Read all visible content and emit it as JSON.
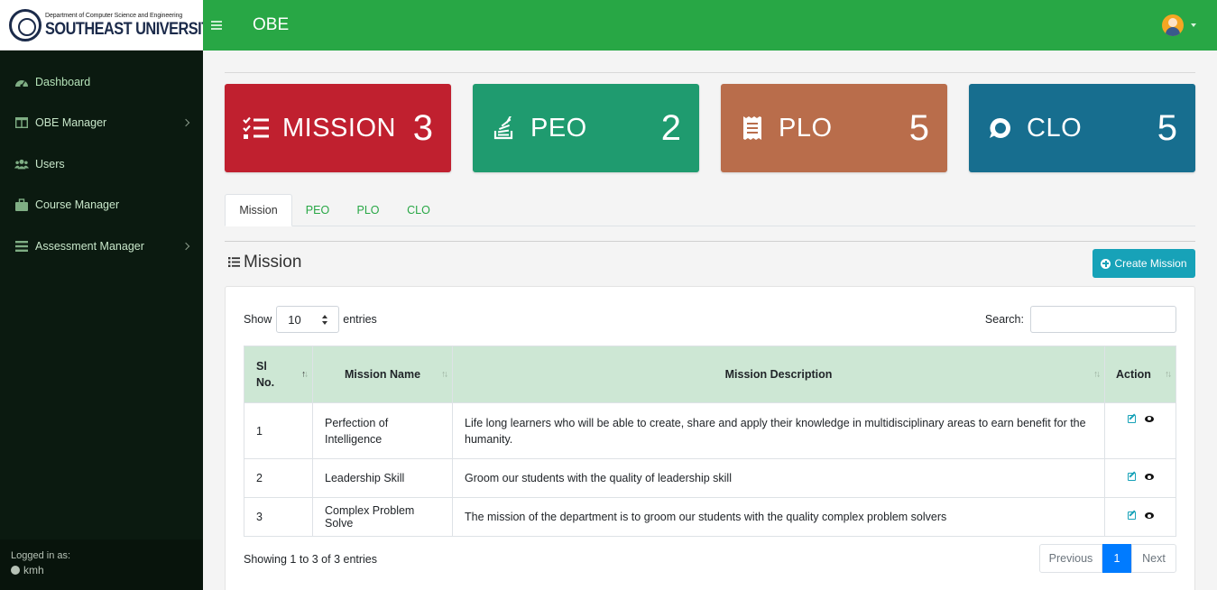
{
  "brand": {
    "dept": "Department of Computer Science and Engineering",
    "name": "SOUTHEAST UNIVERSITY"
  },
  "header": {
    "title": "OBE"
  },
  "sidebar": {
    "items": [
      {
        "label": "Dashboard",
        "icon": "dashboard-icon"
      },
      {
        "label": "OBE Manager",
        "icon": "table-icon",
        "has_submenu": true
      },
      {
        "label": "Users",
        "icon": "users-icon"
      },
      {
        "label": "Course Manager",
        "icon": "briefcase-icon"
      },
      {
        "label": "Assessment Manager",
        "icon": "menu-icon",
        "has_submenu": true
      }
    ],
    "footer": {
      "logged_in_label": "Logged in as:",
      "username": "kmh"
    }
  },
  "stats": [
    {
      "label": "MISSION",
      "value": "3",
      "color": "#c0202f",
      "icon": "tasks-icon"
    },
    {
      "label": "PEO",
      "value": "2",
      "color": "#1f9b6f",
      "icon": "stack-icon"
    },
    {
      "label": "PLO",
      "value": "5",
      "color": "#b96d4b",
      "icon": "receipt-icon"
    },
    {
      "label": "CLO",
      "value": "5",
      "color": "#176e8f",
      "icon": "comment-icon"
    }
  ],
  "tabs": [
    {
      "label": "Mission",
      "active": true
    },
    {
      "label": "PEO"
    },
    {
      "label": "PLO"
    },
    {
      "label": "CLO"
    }
  ],
  "section": {
    "title": "Mission",
    "create_label": "Create Mission"
  },
  "table": {
    "show_label": "Show",
    "entries_label": "entries",
    "length_value": "10",
    "search_label": "Search:",
    "search_value": "",
    "columns": [
      "Sl No.",
      "Mission Name",
      "Mission Description",
      "Action"
    ],
    "rows": [
      {
        "sl": "1",
        "name": "Perfection of Intelligence",
        "description": "Life long learners who will be able to create, share and apply their knowledge in multidisciplinary areas to earn benefit for the humanity."
      },
      {
        "sl": "2",
        "name": "Leadership Skill",
        "description": "Groom our students with the quality of leadership skill"
      },
      {
        "sl": "3",
        "name": "Complex Problem Solve",
        "description": "The mission of the department is to groom our students with the quality complex problem solvers"
      }
    ],
    "info": "Showing 1 to 3 of 3 entries",
    "pager": {
      "previous": "Previous",
      "current": "1",
      "next": "Next"
    }
  }
}
